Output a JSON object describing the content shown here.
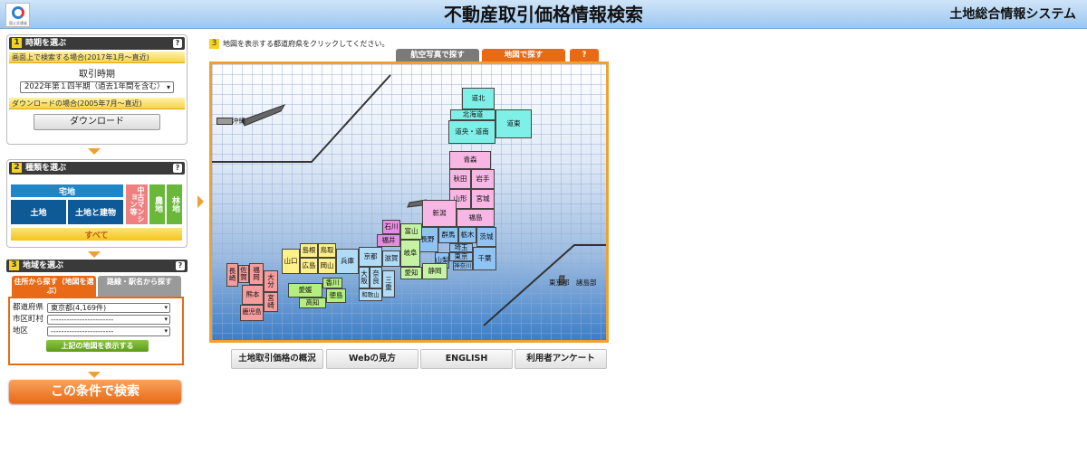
{
  "header": {
    "logo_text": "国土交通省",
    "title": "不動産取引価格情報検索",
    "system_name": "土地総合情報システム"
  },
  "step1": {
    "number": "1",
    "title": "時期を選ぶ",
    "help": "?",
    "screen_search_band": "画面上で検索する場合(2017年1月～直近)",
    "period_label": "取引時期",
    "period_value": "2022年第１四半期（過去1年間を含む）",
    "download_band": "ダウンロードの場合(2005年7月～直近)",
    "download_button": "ダウンロード"
  },
  "step2": {
    "number": "2",
    "title": "種類を選ぶ",
    "help": "?",
    "types": {
      "residential": "宅地",
      "land": "土地",
      "land_building": "土地と建物",
      "mansion": "中古マンション等",
      "farmland": "農地",
      "forest": "林地",
      "all": "すべて"
    }
  },
  "step3_left": {
    "number": "3",
    "title": "地域を選ぶ",
    "help": "?",
    "tab_address": "住所から探す（地図を選ぶ）",
    "tab_route": "路線・駅名から探す",
    "prefecture_label": "都道府県",
    "prefecture_value": "東京都(4,169件)",
    "city_label": "市区町村",
    "city_value": "------------------------",
    "district_label": "地区",
    "district_value": "------------------------",
    "show_map_button": "上記の地図を表示する"
  },
  "search_button": "この条件で検索",
  "map": {
    "step_number": "3",
    "instruction": "地図を表示する都道府県をクリックしてください。",
    "tab_aerial": "航空写真で探す",
    "tab_map": "地図で探す",
    "tab_help": "?",
    "prefectures": {
      "dohoku": "道北",
      "hokkaido": "北海道",
      "doou": "道央・道南",
      "doto": "道東",
      "aomori": "青森",
      "akita": "秋田",
      "iwate": "岩手",
      "yamagata": "山形",
      "miyagi": "宮城",
      "fukushima": "福島",
      "niigata": "新潟",
      "gunma": "群馬",
      "tochigi": "栃木",
      "ibaraki": "茨城",
      "saitama": "埼玉",
      "tokyo": "東京",
      "chiba": "千葉",
      "kanagawa": "神奈川",
      "yamanashi": "山梨",
      "nagano": "長野",
      "toyama": "富山",
      "ishikawa": "石川",
      "fukui": "福井",
      "gifu": "岐阜",
      "shizuoka": "静岡",
      "aichi": "愛知",
      "mie": "三重",
      "shiga": "滋賀",
      "kyoto": "京都",
      "osaka": "大阪",
      "hyogo": "兵庫",
      "nara": "奈良",
      "wakayama": "和歌山",
      "tottori": "鳥取",
      "shimane": "島根",
      "okayama": "岡山",
      "hiroshima": "広島",
      "yamaguchi": "山口",
      "kagawa": "香川",
      "tokushima": "徳島",
      "ehime": "愛媛",
      "kochi": "高知",
      "fukuoka": "福岡",
      "saga": "佐賀",
      "nagasaki": "長崎",
      "kumamoto": "熊本",
      "oita": "大分",
      "miyazaki": "宮崎",
      "kagoshima": "鹿児島",
      "okinawa": "沖縄",
      "tokyo_islands": "東京都　諸島部"
    }
  },
  "bottom_links": {
    "overview": "土地取引価格の概況",
    "howto": "Webの見方",
    "english": "ENGLISH",
    "survey": "利用者アンケート"
  },
  "colors": {
    "header": "#9cc7ef",
    "accent_orange": "#e86a16",
    "map_frame": "#f0a030",
    "residential_blue": "#1f86c8",
    "land_dark_blue": "#0e5a96",
    "mansion_pink": "#f08080",
    "farm_green": "#6ab83a",
    "all_yellow": "#f5c518"
  }
}
